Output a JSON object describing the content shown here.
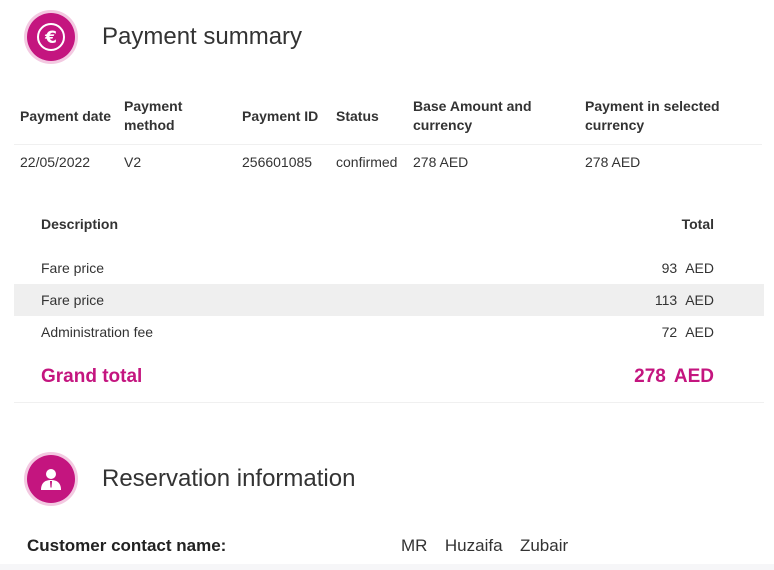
{
  "payment_summary": {
    "title": "Payment summary",
    "icon": "euro-icon",
    "columns": [
      "Payment date",
      "Payment method",
      "Payment ID",
      "Status",
      "Base Amount and currency",
      "Payment in selected currency"
    ],
    "row": {
      "date": "22/05/2022",
      "method": "V2",
      "id": "256601085",
      "status": "confirmed",
      "base_amount": "278 AED",
      "selected_amount": "278 AED"
    }
  },
  "breakdown": {
    "description_header": "Description",
    "total_header": "Total",
    "items": [
      {
        "label": "Fare price",
        "amount": "93",
        "currency": "AED"
      },
      {
        "label": "Fare price",
        "amount": "113",
        "currency": "AED"
      },
      {
        "label": "Administration fee",
        "amount": "72",
        "currency": "AED"
      }
    ],
    "grand_total": {
      "label": "Grand total",
      "amount": "278",
      "currency": "AED"
    }
  },
  "reservation": {
    "title": "Reservation information",
    "icon": "user-icon",
    "contact_label": "Customer contact name:",
    "contact_value": "MR  Huzaifa  Zubair"
  },
  "colors": {
    "accent": "#c4157f",
    "icon_ring": "#f3c9e1",
    "row_alt": "#efefef"
  }
}
